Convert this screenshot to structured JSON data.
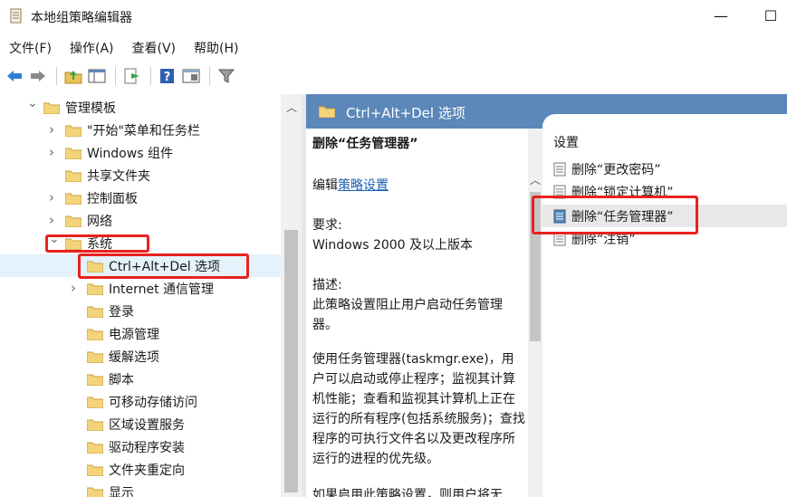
{
  "window": {
    "title": "本地组策略编辑器",
    "minimize": "—",
    "maximize": "☐"
  },
  "menu": [
    "文件(F)",
    "操作(A)",
    "查看(V)",
    "帮助(H)"
  ],
  "toolbar": {
    "icons": [
      "back-icon",
      "forward-icon",
      "up-folder-icon",
      "show-hide-tree-icon",
      "export-list-icon",
      "help-icon",
      "properties-icon",
      "filter-icon"
    ]
  },
  "tree": {
    "items": [
      {
        "label": "管理模板",
        "indent": 0,
        "chevron": "down"
      },
      {
        "label": "\"开始\"菜单和任务栏",
        "indent": 1,
        "chevron": "right"
      },
      {
        "label": "Windows 组件",
        "indent": 1,
        "chevron": "right"
      },
      {
        "label": "共享文件夹",
        "indent": 1,
        "chevron": "none"
      },
      {
        "label": "控制面板",
        "indent": 1,
        "chevron": "right"
      },
      {
        "label": "网络",
        "indent": 1,
        "chevron": "right"
      },
      {
        "label": "系统",
        "indent": 1,
        "chevron": "down"
      },
      {
        "label": "Ctrl+Alt+Del 选项",
        "indent": 2,
        "chevron": "none",
        "selected": true
      },
      {
        "label": "Internet 通信管理",
        "indent": 2,
        "chevron": "right"
      },
      {
        "label": "登录",
        "indent": 2,
        "chevron": "none"
      },
      {
        "label": "电源管理",
        "indent": 2,
        "chevron": "none"
      },
      {
        "label": "缓解选项",
        "indent": 2,
        "chevron": "none"
      },
      {
        "label": "脚本",
        "indent": 2,
        "chevron": "none"
      },
      {
        "label": "可移动存储访问",
        "indent": 2,
        "chevron": "none"
      },
      {
        "label": "区域设置服务",
        "indent": 2,
        "chevron": "none"
      },
      {
        "label": "驱动程序安装",
        "indent": 2,
        "chevron": "none"
      },
      {
        "label": "文件夹重定向",
        "indent": 2,
        "chevron": "none"
      },
      {
        "label": "显示",
        "indent": 2,
        "chevron": "none"
      }
    ]
  },
  "right": {
    "header": "Ctrl+Alt+Del 选项",
    "desc": {
      "title": "删除“任务管理器”",
      "edit_prefix": "编辑",
      "edit_link": "策略设置",
      "req_label": "要求:",
      "req_value": "Windows 2000 及以上版本",
      "desc_label": "描述:",
      "desc_text": "此策略设置阻止用户启动任务管理器。",
      "usage_text": "使用任务管理器(taskmgr.exe)，用户可以启动或停止程序；监视其计算机性能；查看和监视其计算机上正在运行的所有程序(包括系统服务)；查找程序的可执行文件名以及更改程序所运行的进程的优先级。",
      "more_text": "如果启用此策略设置，则用户将无"
    },
    "list": {
      "heading": "设置",
      "items": [
        "删除“更改密码”",
        "删除“锁定计算机”",
        "删除“任务管理器”",
        "删除“注销”"
      ]
    }
  }
}
